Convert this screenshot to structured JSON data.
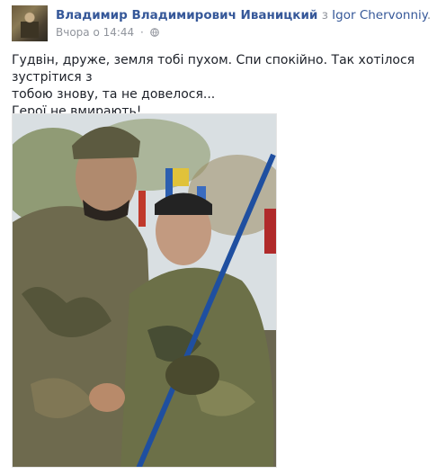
{
  "post": {
    "author": "Владимир Владимирович Иваницкий",
    "with_word": "з",
    "tagged_user": "Igor Chervonniy",
    "tagged_suffix": ".",
    "timestamp": "Вчора о 14:44",
    "separator": "·",
    "privacy_icon": "globe-icon",
    "text_lines": [
      "Гудвін, друже, земля тобі пухом. Спи спокійно. Так хотілося зустрітися з",
      "тобою знову, та не довелося...",
      "Герої не вмирають!"
    ]
  },
  "colors": {
    "link": "#365899",
    "meta": "#90949c",
    "text": "#1d2129"
  }
}
